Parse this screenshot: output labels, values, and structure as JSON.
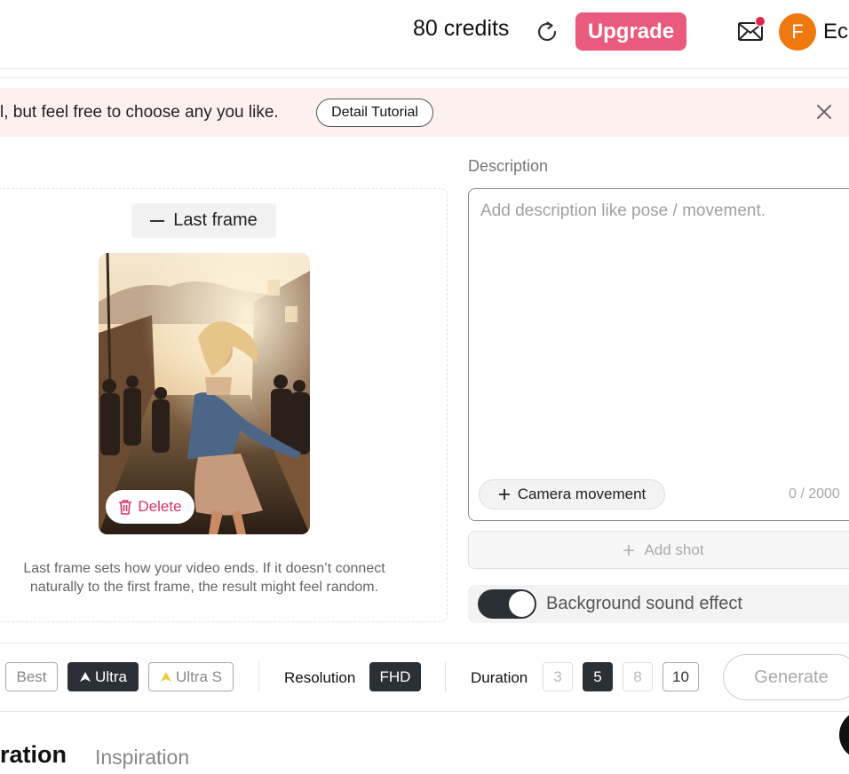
{
  "header": {
    "credits": "80 credits",
    "upgrade_label": "Upgrade",
    "avatar_initial": "F",
    "username": "Ecl"
  },
  "banner": {
    "text": "l, but feel free to choose any you like.",
    "tutorial_label": "Detail Tutorial"
  },
  "frame": {
    "last_frame_label": "Last frame",
    "delete_label": "Delete",
    "hint": "Last frame sets how your video ends. If it doesn’t connect naturally to the first frame, the result might feel random."
  },
  "description": {
    "label": "Description",
    "placeholder": "Add description like pose / movement.",
    "camera_movement_label": "Camera movement",
    "counter": "0 / 2000",
    "add_shot_label": "Add shot",
    "sound_label": "Background sound effect",
    "sound_enabled": true
  },
  "toolbar": {
    "quality_options": [
      "Best",
      "Ultra",
      "Ultra S"
    ],
    "quality_selected": "Ultra",
    "resolution_label": "Resolution",
    "resolution_value": "FHD",
    "duration_label": "Duration",
    "duration_options": [
      "3",
      "5",
      "8",
      "10"
    ],
    "duration_selected": "5",
    "generate_label": "Generate"
  },
  "tabs": {
    "active": "ration",
    "inactive": "Inspiration"
  },
  "colors": {
    "accent": "#ea5a7d",
    "avatar": "#f0790f",
    "dark": "#2b2f36",
    "banner_bg": "#fdf1f0",
    "delete": "#d6336c"
  },
  "icons": [
    "refresh-icon",
    "mail-icon",
    "close-icon",
    "minus-icon",
    "trash-icon",
    "plus-icon",
    "ultra-icon"
  ]
}
